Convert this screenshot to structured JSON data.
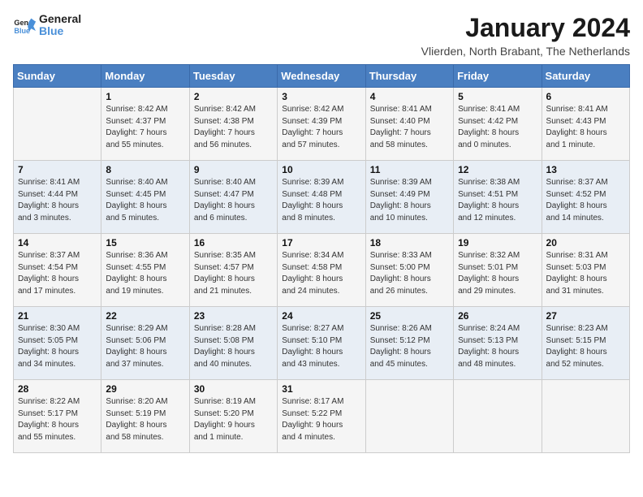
{
  "logo": {
    "text_general": "General",
    "text_blue": "Blue"
  },
  "header": {
    "title": "January 2024",
    "subtitle": "Vlierden, North Brabant, The Netherlands"
  },
  "weekdays": [
    "Sunday",
    "Monday",
    "Tuesday",
    "Wednesday",
    "Thursday",
    "Friday",
    "Saturday"
  ],
  "weeks": [
    [
      {
        "day": "",
        "info": ""
      },
      {
        "day": "1",
        "info": "Sunrise: 8:42 AM\nSunset: 4:37 PM\nDaylight: 7 hours\nand 55 minutes."
      },
      {
        "day": "2",
        "info": "Sunrise: 8:42 AM\nSunset: 4:38 PM\nDaylight: 7 hours\nand 56 minutes."
      },
      {
        "day": "3",
        "info": "Sunrise: 8:42 AM\nSunset: 4:39 PM\nDaylight: 7 hours\nand 57 minutes."
      },
      {
        "day": "4",
        "info": "Sunrise: 8:41 AM\nSunset: 4:40 PM\nDaylight: 7 hours\nand 58 minutes."
      },
      {
        "day": "5",
        "info": "Sunrise: 8:41 AM\nSunset: 4:42 PM\nDaylight: 8 hours\nand 0 minutes."
      },
      {
        "day": "6",
        "info": "Sunrise: 8:41 AM\nSunset: 4:43 PM\nDaylight: 8 hours\nand 1 minute."
      }
    ],
    [
      {
        "day": "7",
        "info": "Sunrise: 8:41 AM\nSunset: 4:44 PM\nDaylight: 8 hours\nand 3 minutes."
      },
      {
        "day": "8",
        "info": "Sunrise: 8:40 AM\nSunset: 4:45 PM\nDaylight: 8 hours\nand 5 minutes."
      },
      {
        "day": "9",
        "info": "Sunrise: 8:40 AM\nSunset: 4:47 PM\nDaylight: 8 hours\nand 6 minutes."
      },
      {
        "day": "10",
        "info": "Sunrise: 8:39 AM\nSunset: 4:48 PM\nDaylight: 8 hours\nand 8 minutes."
      },
      {
        "day": "11",
        "info": "Sunrise: 8:39 AM\nSunset: 4:49 PM\nDaylight: 8 hours\nand 10 minutes."
      },
      {
        "day": "12",
        "info": "Sunrise: 8:38 AM\nSunset: 4:51 PM\nDaylight: 8 hours\nand 12 minutes."
      },
      {
        "day": "13",
        "info": "Sunrise: 8:37 AM\nSunset: 4:52 PM\nDaylight: 8 hours\nand 14 minutes."
      }
    ],
    [
      {
        "day": "14",
        "info": "Sunrise: 8:37 AM\nSunset: 4:54 PM\nDaylight: 8 hours\nand 17 minutes."
      },
      {
        "day": "15",
        "info": "Sunrise: 8:36 AM\nSunset: 4:55 PM\nDaylight: 8 hours\nand 19 minutes."
      },
      {
        "day": "16",
        "info": "Sunrise: 8:35 AM\nSunset: 4:57 PM\nDaylight: 8 hours\nand 21 minutes."
      },
      {
        "day": "17",
        "info": "Sunrise: 8:34 AM\nSunset: 4:58 PM\nDaylight: 8 hours\nand 24 minutes."
      },
      {
        "day": "18",
        "info": "Sunrise: 8:33 AM\nSunset: 5:00 PM\nDaylight: 8 hours\nand 26 minutes."
      },
      {
        "day": "19",
        "info": "Sunrise: 8:32 AM\nSunset: 5:01 PM\nDaylight: 8 hours\nand 29 minutes."
      },
      {
        "day": "20",
        "info": "Sunrise: 8:31 AM\nSunset: 5:03 PM\nDaylight: 8 hours\nand 31 minutes."
      }
    ],
    [
      {
        "day": "21",
        "info": "Sunrise: 8:30 AM\nSunset: 5:05 PM\nDaylight: 8 hours\nand 34 minutes."
      },
      {
        "day": "22",
        "info": "Sunrise: 8:29 AM\nSunset: 5:06 PM\nDaylight: 8 hours\nand 37 minutes."
      },
      {
        "day": "23",
        "info": "Sunrise: 8:28 AM\nSunset: 5:08 PM\nDaylight: 8 hours\nand 40 minutes."
      },
      {
        "day": "24",
        "info": "Sunrise: 8:27 AM\nSunset: 5:10 PM\nDaylight: 8 hours\nand 43 minutes."
      },
      {
        "day": "25",
        "info": "Sunrise: 8:26 AM\nSunset: 5:12 PM\nDaylight: 8 hours\nand 45 minutes."
      },
      {
        "day": "26",
        "info": "Sunrise: 8:24 AM\nSunset: 5:13 PM\nDaylight: 8 hours\nand 48 minutes."
      },
      {
        "day": "27",
        "info": "Sunrise: 8:23 AM\nSunset: 5:15 PM\nDaylight: 8 hours\nand 52 minutes."
      }
    ],
    [
      {
        "day": "28",
        "info": "Sunrise: 8:22 AM\nSunset: 5:17 PM\nDaylight: 8 hours\nand 55 minutes."
      },
      {
        "day": "29",
        "info": "Sunrise: 8:20 AM\nSunset: 5:19 PM\nDaylight: 8 hours\nand 58 minutes."
      },
      {
        "day": "30",
        "info": "Sunrise: 8:19 AM\nSunset: 5:20 PM\nDaylight: 9 hours\nand 1 minute."
      },
      {
        "day": "31",
        "info": "Sunrise: 8:17 AM\nSunset: 5:22 PM\nDaylight: 9 hours\nand 4 minutes."
      },
      {
        "day": "",
        "info": ""
      },
      {
        "day": "",
        "info": ""
      },
      {
        "day": "",
        "info": ""
      }
    ]
  ]
}
